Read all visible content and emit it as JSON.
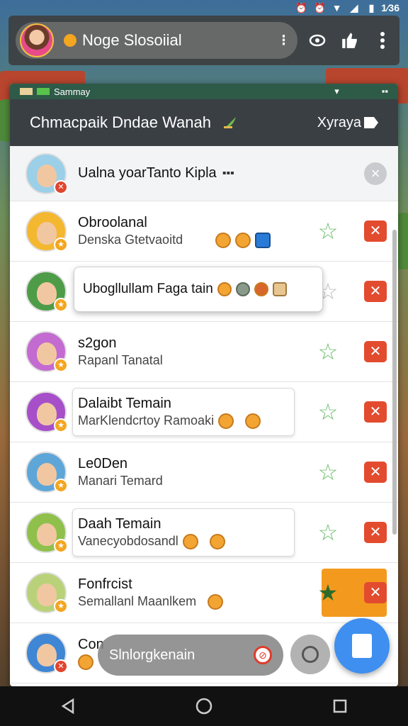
{
  "status": {
    "time": "1⁄36"
  },
  "app_bar": {
    "title": "Noge Slosoiial",
    "menu_glyph": "⁝"
  },
  "panel": {
    "strip_label": "Sammay",
    "strip_right": [
      "▾",
      "▪▪"
    ],
    "header_title": "Chmacpaik Dndae Wanah",
    "header_right": "Xyraya"
  },
  "first_row": {
    "title": "Ualna yoarTanto Kipla",
    "suffix": "▪▪▪"
  },
  "rows": [
    {
      "name": "Obroolanal",
      "sub": "Denska Gtetvaoitd"
    },
    {
      "name": "",
      "sub": ""
    },
    {
      "name": "s2gon",
      "sub": "Rapanl Tanatal"
    },
    {
      "name": "Dalaibt Temain",
      "sub": "MarKlendcrtoy Ramoaki"
    },
    {
      "name": "Le0Den",
      "sub": "Manari Temard"
    },
    {
      "name": "Daah Temain",
      "sub": "Vanecyobdosandl"
    },
    {
      "name": "Fonfrcist",
      "sub": "Semallanl Maanlkem"
    },
    {
      "name": "Con",
      "sub": ""
    }
  ],
  "tooltip": {
    "text": "Ubogllullam Faga tain"
  },
  "search_pill": {
    "label": "Slnlorgkenain"
  },
  "colors": {
    "accent_red": "#e34b2f",
    "star_green": "#6dbb6a",
    "orange": "#f39a1e",
    "fab_blue": "#3e8ff0"
  }
}
